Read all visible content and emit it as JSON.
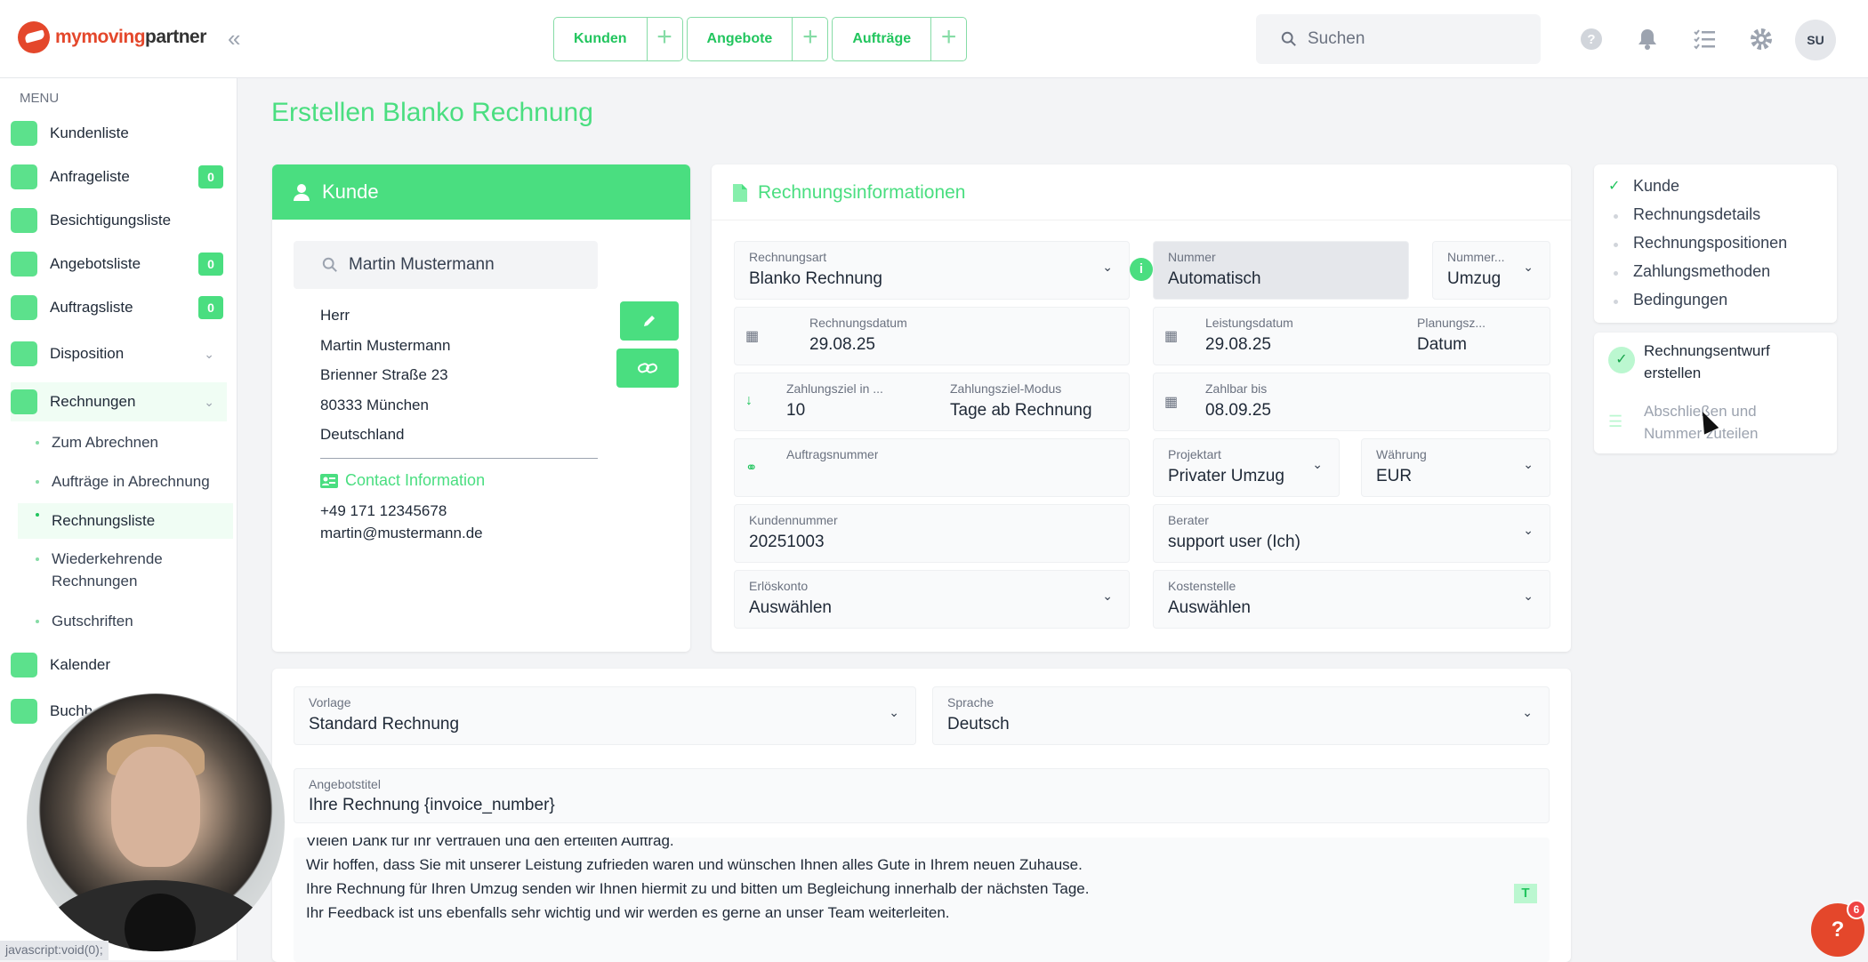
{
  "topbar": {
    "logo_text_1": "mymoving",
    "logo_text_2": "partner",
    "collapse_icon": "«",
    "nav": [
      {
        "label": "Kunden"
      },
      {
        "label": "Angebote"
      },
      {
        "label": "Aufträge"
      }
    ],
    "search_placeholder": "Suchen",
    "avatar": "SU"
  },
  "sidebar": {
    "menu_label": "MENU",
    "items": [
      {
        "label": "Kundenliste"
      },
      {
        "label": "Anfrageliste",
        "badge": "0"
      },
      {
        "label": "Besichtigungsliste"
      },
      {
        "label": "Angebotsliste",
        "badge": "0"
      },
      {
        "label": "Auftragsliste",
        "badge": "0"
      },
      {
        "label": "Disposition"
      },
      {
        "label": "Rechnungen"
      }
    ],
    "sub_items": [
      {
        "label": "Zum Abrechnen"
      },
      {
        "label": "Aufträge in Abrechnung"
      },
      {
        "label": "Rechnungsliste"
      },
      {
        "label": "Wiederkehrende Rechnungen"
      },
      {
        "label": "Gutschriften"
      }
    ],
    "calendar_label": "Kalender",
    "buch_label": "Buchh"
  },
  "page": {
    "title": "Erstellen Blanko Rechnung"
  },
  "kunde": {
    "header": "Kunde",
    "search_value": "Martin Mustermann",
    "address": [
      "Herr",
      "Martin Mustermann",
      "Brienner Straße 23",
      "80333 München",
      "Deutschland"
    ],
    "contact_header": "Contact Information",
    "phone": "+49 171 12345678",
    "email": "martin@mustermann.de"
  },
  "invoice": {
    "header": "Rechnungsinformationen",
    "fields": {
      "rechnungsart": {
        "label": "Rechnungsart",
        "value": "Blanko Rechnung"
      },
      "nummer": {
        "label": "Nummer",
        "value": "Automatisch"
      },
      "nummer_kreis": {
        "label": "Nummer...",
        "value": "Umzug"
      },
      "rechnungsdatum": {
        "label": "Rechnungsdatum",
        "value": "29.08.25"
      },
      "leistungsdatum": {
        "label": "Leistungsdatum",
        "value": "29.08.25"
      },
      "planungsz": {
        "label": "Planungsz...",
        "value": "Datum"
      },
      "zahlungsziel": {
        "label": "Zahlungsziel in ...",
        "value": "10"
      },
      "zahlungsziel_modus": {
        "label": "Zahlungsziel-Modus",
        "value": "Tage ab Rechnung"
      },
      "zahlbar_bis": {
        "label": "Zahlbar bis",
        "value": "08.09.25"
      },
      "auftragsnummer": {
        "label": "Auftragsnummer",
        "value": ""
      },
      "projektart": {
        "label": "Projektart",
        "value": "Privater Umzug"
      },
      "waehrung": {
        "label": "Währung",
        "value": "EUR"
      },
      "kundennummer": {
        "label": "Kundennummer",
        "value": "20251003"
      },
      "berater": {
        "label": "Berater",
        "value": "support user (Ich)"
      },
      "erloeskonto": {
        "label": "Erlöskonto",
        "value": "Auswählen"
      },
      "kostenstelle": {
        "label": "Kostenstelle",
        "value": "Auswählen"
      }
    }
  },
  "steps": [
    "Kunde",
    "Rechnungsdetails",
    "Rechnungspositionen",
    "Zahlungsmethoden",
    "Bedingungen"
  ],
  "actions": {
    "draft_1": "Rechnungsentwurf",
    "draft_2": "erstellen",
    "finish_1": "Abschließen und",
    "finish_2": "Nummer zuteilen"
  },
  "bottom": {
    "vorlage": {
      "label": "Vorlage",
      "value": "Standard Rechnung"
    },
    "sprache": {
      "label": "Sprache",
      "value": "Deutsch"
    },
    "angebotstitel": {
      "label": "Angebotstitel",
      "value": "Ihre Rechnung {invoice_number}"
    },
    "text_lines": [
      "Vielen Dank für Ihr Vertrauen und den erteilten Auftrag.",
      "Wir hoffen, dass Sie mit unserer Leistung zufrieden waren und wünschen Ihnen alles Gute in Ihrem neuen Zuhause.",
      "Ihre Rechnung für Ihren Umzug senden wir Ihnen hiermit zu und bitten um Begleichung innerhalb der nächsten Tage.",
      "Ihr Feedback ist uns ebenfalls sehr wichtig und wir werden es gerne an unser Team weiterleiten."
    ]
  },
  "statusbar": "javascript:void(0);",
  "help": {
    "label": "?",
    "count": "6"
  },
  "colors": {
    "accent": "#4ade80",
    "brand": "#e4472b"
  }
}
